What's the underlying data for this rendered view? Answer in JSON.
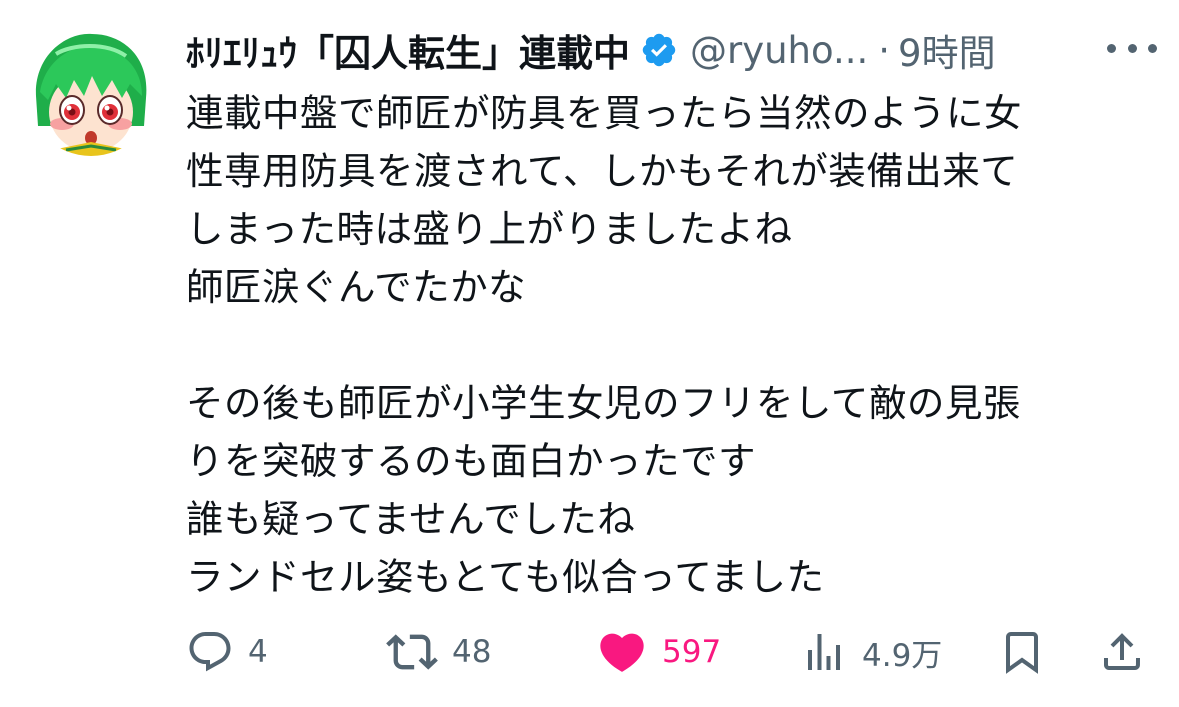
{
  "author": {
    "display_name": "ﾎﾘｴﾘｭｳ「囚人転生」連載中",
    "handle": "@ryuho...",
    "separator": "·",
    "time": "9時間",
    "verified_badge_color": "#1d9bf0",
    "avatar_icon": "avatar-anime-girl-green-hair"
  },
  "more_icon": "more-dots-icon",
  "body": {
    "lines": [
      "連載中盤で師匠が防具を買ったら当然のように女",
      "性専用防具を渡されて、しかもそれが装備出来て",
      "しまった時は盛り上がりましたよね",
      "師匠涙ぐんでたかな",
      "",
      "その後も師匠が小学生女児のフリをして敵の見張",
      "りを突破するのも面白かったです",
      "誰も疑ってませんでしたね",
      "ランドセル姿もとても似合ってました"
    ]
  },
  "actions": {
    "reply": {
      "icon": "reply-bubble-icon",
      "count": "4"
    },
    "retweet": {
      "icon": "retweet-icon",
      "count": "48"
    },
    "like": {
      "icon": "heart-filled-icon",
      "count": "597",
      "color": "#f91880"
    },
    "views": {
      "icon": "views-bar-icon",
      "count": "4.9万"
    },
    "bookmark": {
      "icon": "bookmark-icon"
    },
    "share": {
      "icon": "share-upload-icon"
    }
  },
  "colors": {
    "text_primary": "#0f1419",
    "text_secondary": "#536471",
    "accent_blue": "#1d9bf0",
    "like_pink": "#f91880"
  }
}
